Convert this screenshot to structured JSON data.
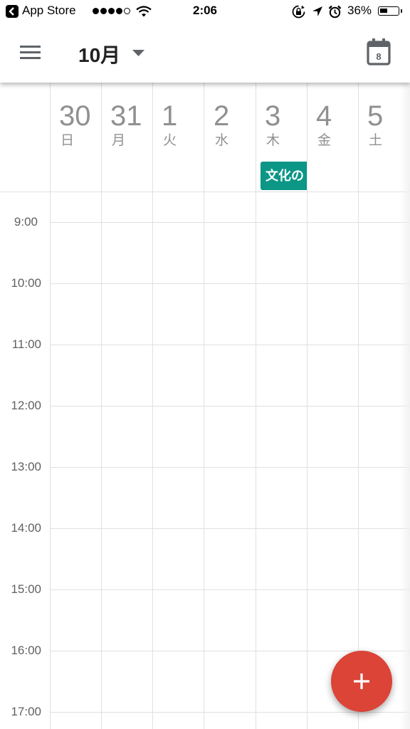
{
  "status_bar": {
    "back_app": "App Store",
    "time": "2:06",
    "battery": "36%",
    "icons": [
      "back-arrow-icon",
      "signal-dots-icon",
      "wifi-icon",
      "orientation-lock-icon",
      "location-arrow-icon",
      "alarm-icon",
      "battery-icon"
    ]
  },
  "app_bar": {
    "month": "10月",
    "today_date": "8",
    "icons": [
      "hamburger-menu-icon",
      "dropdown-caret-icon",
      "calendar-today-icon"
    ]
  },
  "days": [
    {
      "num": "30",
      "weekday": "日"
    },
    {
      "num": "31",
      "weekday": "月"
    },
    {
      "num": "1",
      "weekday": "火"
    },
    {
      "num": "2",
      "weekday": "水"
    },
    {
      "num": "3",
      "weekday": "木"
    },
    {
      "num": "4",
      "weekday": "金"
    },
    {
      "num": "5",
      "weekday": "土"
    }
  ],
  "all_day_event": {
    "label": "文化の",
    "day": "3",
    "color": "#0b9686"
  },
  "hours": [
    "9:00",
    "10:00",
    "11:00",
    "12:00",
    "13:00",
    "14:00",
    "15:00",
    "16:00",
    "17:00"
  ],
  "fab": {
    "icon": "plus-icon",
    "color": "#db4437"
  }
}
